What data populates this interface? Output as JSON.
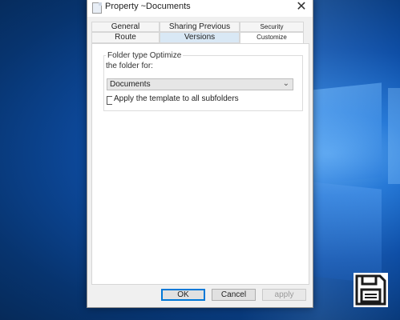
{
  "dialog": {
    "title": "Property ~Documents",
    "close_glyph": "✕",
    "tabs_row1": [
      {
        "label": "General"
      },
      {
        "label": "Sharing Previous"
      },
      {
        "label": "Security"
      }
    ],
    "tabs_row2": [
      {
        "label": "Route"
      },
      {
        "label": "Versions"
      },
      {
        "label": "Customize"
      }
    ],
    "group": {
      "title": "Folder type Optimize",
      "subtitle": "the folder for:",
      "combo_value": "Documents",
      "checkbox_label": "Apply the template to all subfolders",
      "checkbox_checked": false
    },
    "buttons": {
      "ok": "OK",
      "cancel": "Cancel",
      "apply": "apply"
    }
  },
  "desktop": {
    "save_icon": "floppy-disk-icon"
  },
  "colors": {
    "accent": "#0078d7",
    "desktop_blue": "#0e4ea6"
  }
}
